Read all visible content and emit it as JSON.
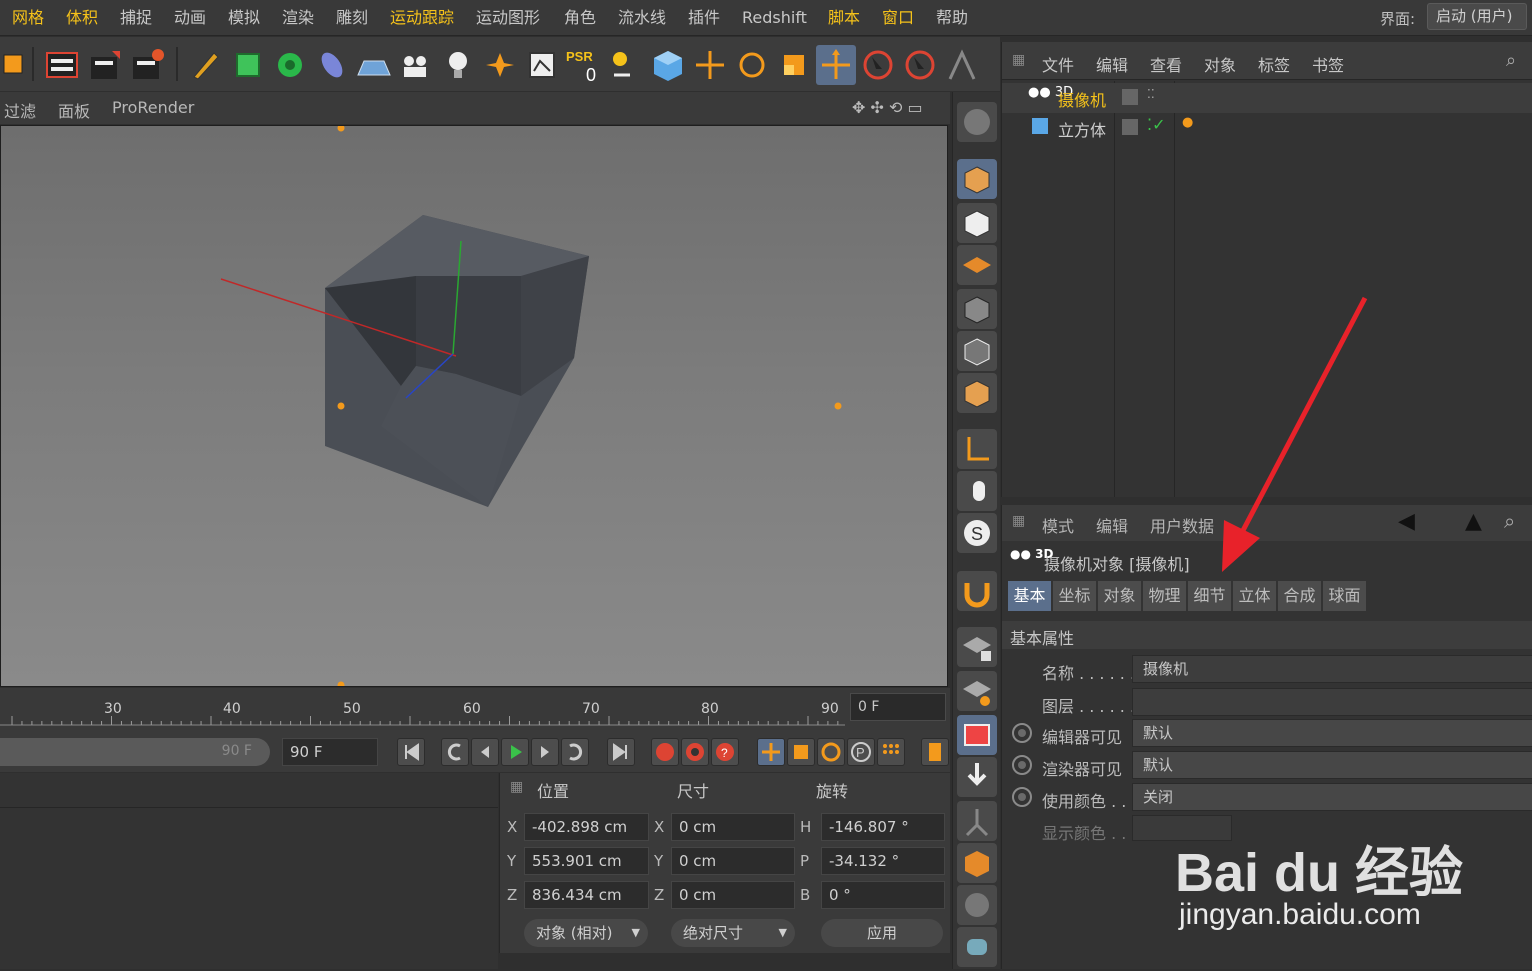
{
  "menu": {
    "items": [
      "网格",
      "体积",
      "捕捉",
      "动画",
      "模拟",
      "渲染",
      "雕刻",
      "运动跟踪",
      "运动图形",
      "角色",
      "流水线",
      "插件",
      "Redshift",
      "脚本",
      "窗口",
      "帮助"
    ],
    "highlighted": [
      0,
      1,
      7,
      13,
      14
    ],
    "ui_label": "界面:",
    "ui_value": "启动 (用户)"
  },
  "toolbar": {
    "psr_label": "PSR",
    "psr_value": "0",
    "icons": [
      "render-region-icon",
      "render-view-icon",
      "render-picture-icon",
      "render-settings-icon",
      "pen-icon",
      "cube-select-icon",
      "cloner-icon",
      "deformer-icon",
      "floor-icon",
      "camera-icon",
      "light-icon",
      "explode-icon",
      "render-queue-icon",
      "psr-icon",
      "xyz-icon",
      "object-icon",
      "move-icon",
      "rotate-icon",
      "scale-icon",
      "move-tool-icon",
      "live-select-icon",
      "rect-select-icon",
      "lock-icon"
    ]
  },
  "viewport_menu": {
    "items": [
      "过滤",
      "面板",
      "ProRender"
    ]
  },
  "timeline": {
    "ticks": [
      "30",
      "40",
      "50",
      "60",
      "70",
      "80",
      "90"
    ],
    "current_frame": "0 F",
    "end_frame_ghost": "90 F",
    "end_frame": "90 F"
  },
  "coordinates": {
    "headers": {
      "position": "位置",
      "size": "尺寸",
      "rotation": "旋转"
    },
    "rows": [
      {
        "axis": "X",
        "pos": "-402.898 cm",
        "size_axis": "X",
        "size": "0 cm",
        "rot_axis": "H",
        "rot": "-146.807 °"
      },
      {
        "axis": "Y",
        "pos": "553.901 cm",
        "size_axis": "Y",
        "size": "0 cm",
        "rot_axis": "P",
        "rot": "-34.132 °"
      },
      {
        "axis": "Z",
        "pos": "836.434 cm",
        "size_axis": "Z",
        "size": "0 cm",
        "rot_axis": "B",
        "rot": "0 °"
      }
    ],
    "mode_select": "对象 (相对)",
    "size_select": "绝对尺寸",
    "apply_label": "应用"
  },
  "object_manager": {
    "menu": [
      "文件",
      "编辑",
      "查看",
      "对象",
      "标签",
      "书签"
    ],
    "objects": [
      {
        "name": "摄像机",
        "selected": true
      },
      {
        "name": "立方体",
        "selected": false
      }
    ]
  },
  "attributes": {
    "menu": [
      "模式",
      "编辑",
      "用户数据"
    ],
    "object_title": "摄像机对象 [摄像机]",
    "tabs": [
      "基本",
      "坐标",
      "对象",
      "物理",
      "细节",
      "立体",
      "合成",
      "球面"
    ],
    "active_tab": 0,
    "section": "基本属性",
    "props": [
      {
        "label": "名称 . . . . . .",
        "value": "摄像机"
      },
      {
        "label": "图层 . . . . . .",
        "value": ""
      },
      {
        "label": "编辑器可见",
        "value": "默认"
      },
      {
        "label": "渲染器可见",
        "value": "默认"
      },
      {
        "label": "使用颜色 . .",
        "value": "关闭"
      },
      {
        "label": "显示颜色 . .",
        "value": ""
      }
    ]
  },
  "watermark": {
    "brand": "Bai du 经验",
    "url": "jingyan.baidu.com"
  },
  "colors": {
    "accent": "#f5c21a",
    "selected_tab": "#5b6f8c",
    "annotation_arrow": "#e8222a"
  }
}
